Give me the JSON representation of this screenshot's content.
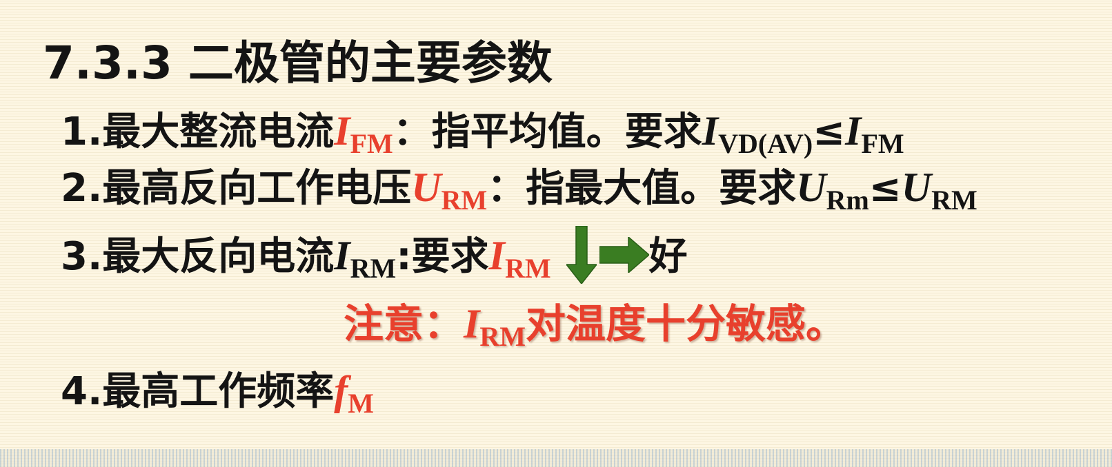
{
  "title": "7.3.3 二极管的主要参数",
  "items": [
    {
      "prefix": "1.最大整流电流",
      "symbol": "I",
      "symbol_sub": "FM",
      "desc": "：指平均值。要求",
      "cond_symbol1": "I",
      "cond_sub1": "VD(AV)",
      "cond_op": "≤",
      "cond_symbol2": "I",
      "cond_sub2": "FM"
    },
    {
      "prefix": "2.最高反向工作电压",
      "symbol": "U",
      "symbol_sub": "RM",
      "desc": "：指最大值。要求",
      "cond_symbol1": "U",
      "cond_sub1": "Rm",
      "cond_op": "≤",
      "cond_symbol2": "U",
      "cond_sub2": "RM"
    },
    {
      "prefix": "3.最大反向电流",
      "symbol": "I",
      "symbol_sub": "RM",
      "desc": ":要求",
      "cond_symbol": "I",
      "cond_sub": "RM",
      "result": "好"
    },
    {
      "prefix": "4.最高工作频率",
      "symbol": "f",
      "symbol_sub": "M"
    }
  ],
  "note": {
    "prefix": "注意：",
    "symbol": "I",
    "symbol_sub": "RM",
    "text": "对温度十分敏感。"
  },
  "colors": {
    "text": "#141414",
    "accent_red": "#e8402d",
    "arrow_green": "#3a7d22",
    "background": "#fdf6e3"
  },
  "icons": [
    "arrow-down-icon",
    "arrow-right-icon"
  ]
}
